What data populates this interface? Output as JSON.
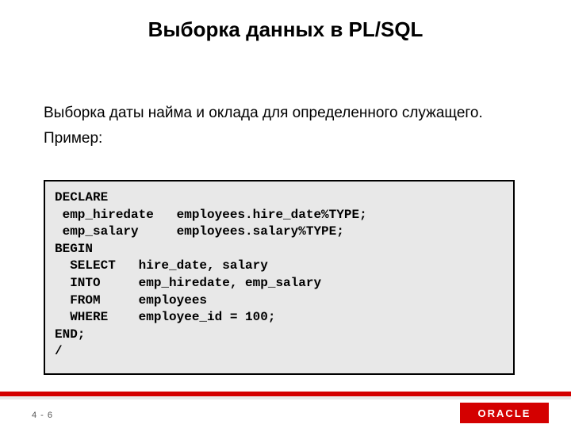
{
  "title": "Выборка данных в PL/SQL",
  "body": {
    "line1": "Выборка даты найма и оклада для определенного служащего.",
    "line2": "Пример:"
  },
  "code": "DECLARE\n emp_hiredate   employees.hire_date%TYPE;\n emp_salary     employees.salary%TYPE;\nBEGIN\n  SELECT   hire_date, salary\n  INTO     emp_hiredate, emp_salary\n  FROM     employees\n  WHERE    employee_id = 100;\nEND;\n/",
  "footer": {
    "page": "4 - 6",
    "logo": "ORACLE"
  },
  "colors": {
    "accent_red": "#d40000",
    "code_bg": "#e8e8e8"
  }
}
